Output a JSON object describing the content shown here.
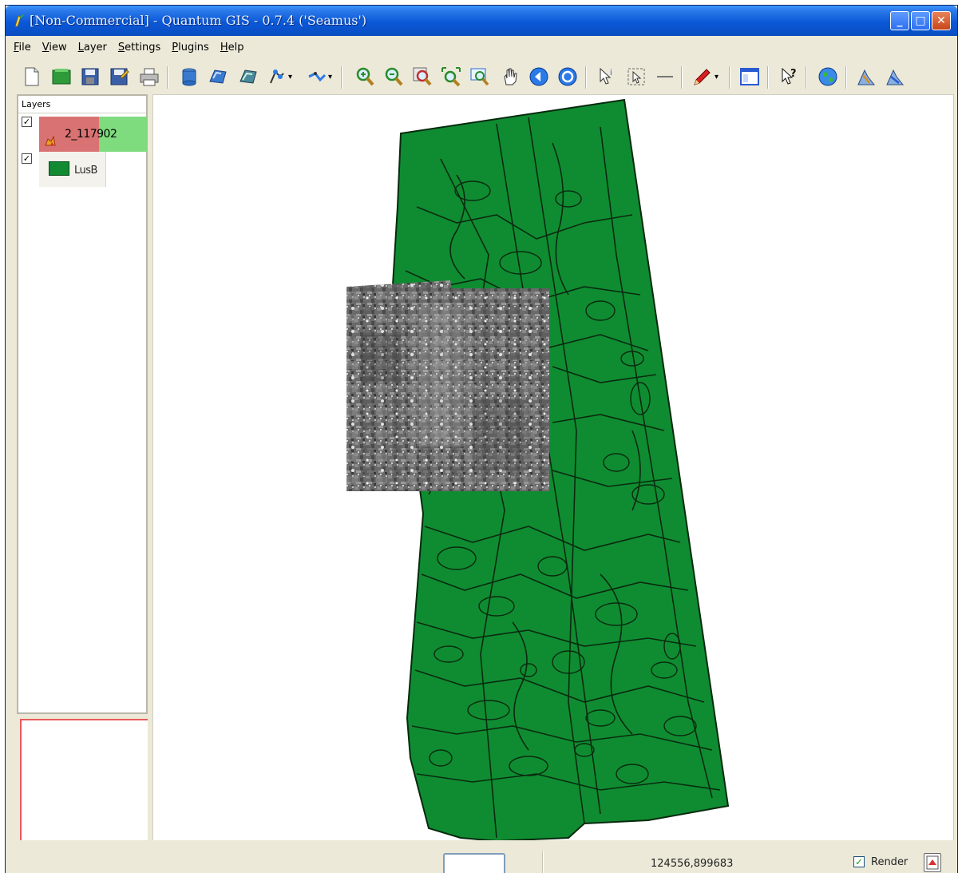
{
  "window": {
    "title": "[Non-Commercial] - Quantum GIS - 0.7.4 ('Seamus')",
    "controls": [
      "minimize",
      "maximize",
      "close"
    ]
  },
  "menu": {
    "items": [
      {
        "label": "File",
        "underline": "F"
      },
      {
        "label": "View",
        "underline": "V"
      },
      {
        "label": "Layer",
        "underline": "L"
      },
      {
        "label": "Settings",
        "underline": "S"
      },
      {
        "label": "Plugins",
        "underline": "P"
      },
      {
        "label": "Help",
        "underline": "H"
      }
    ]
  },
  "toolbar": {
    "buttons": [
      {
        "icon": "new-project-icon"
      },
      {
        "icon": "open-project-icon"
      },
      {
        "icon": "save-project-icon"
      },
      {
        "icon": "save-as-icon"
      },
      {
        "icon": "print-icon"
      },
      {
        "icon": "add-vector-layer-icon"
      },
      {
        "icon": "add-raster-layer-icon"
      },
      {
        "icon": "add-postgis-layer-icon"
      },
      {
        "icon": "capture-point-icon"
      },
      {
        "icon": "capture-line-icon"
      },
      {
        "icon": "zoom-in-icon"
      },
      {
        "icon": "zoom-out-icon"
      },
      {
        "icon": "zoom-full-icon"
      },
      {
        "icon": "zoom-selection-icon"
      },
      {
        "icon": "zoom-last-icon"
      },
      {
        "icon": "pan-icon"
      },
      {
        "icon": "refresh-icon"
      },
      {
        "icon": "measure-icon"
      },
      {
        "icon": "identify-icon"
      },
      {
        "icon": "select-features-icon"
      },
      {
        "icon": "measure-line-icon"
      },
      {
        "icon": "edit-pencil-icon"
      },
      {
        "icon": "overview-icon"
      },
      {
        "icon": "help-whats-this-icon"
      },
      {
        "icon": "globe-icon"
      },
      {
        "icon": "plugin-a-icon"
      },
      {
        "icon": "plugin-b-icon"
      }
    ]
  },
  "layers_panel": {
    "header": "Layers",
    "layers": [
      {
        "name": "2_117902",
        "type": "raster",
        "visible": true
      },
      {
        "name": "LusB",
        "type": "vector",
        "visible": true,
        "color": "#118a32"
      }
    ]
  },
  "map": {
    "polygon_fill": "#0f8c31",
    "outline": "#0a2a10",
    "raster_name": "2_117902"
  },
  "statusbar": {
    "scale_value": "",
    "coordinates": "124556,899683",
    "render_label": "Render",
    "render_checked": true
  }
}
